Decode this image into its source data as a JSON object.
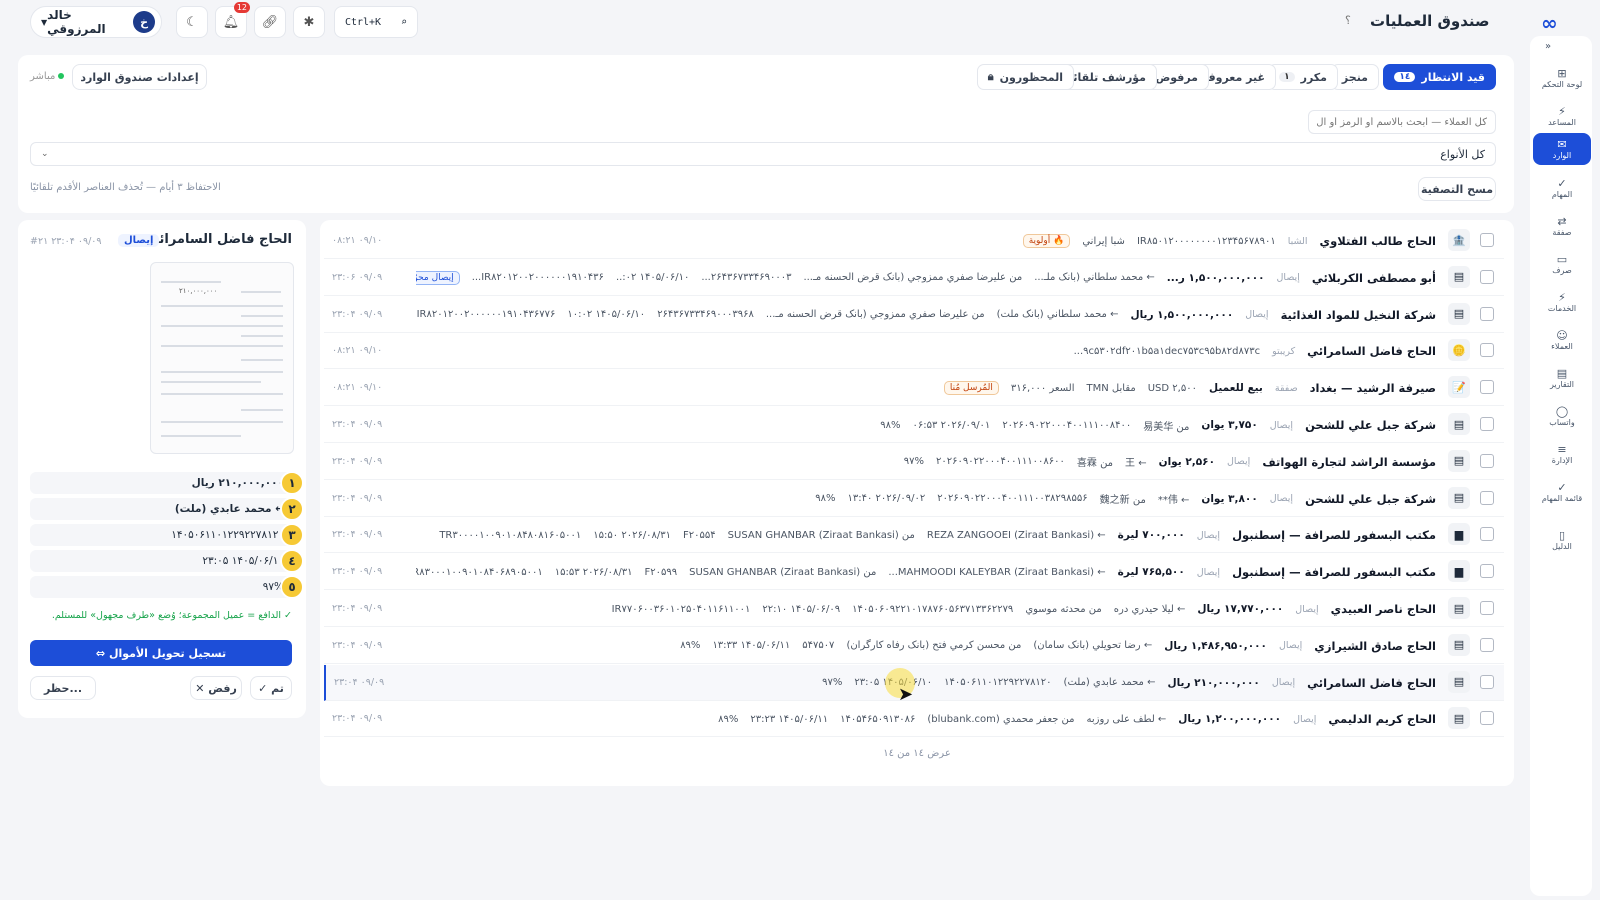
{
  "topbar": {
    "user_name": "خالد المرزوقي",
    "user_initial": "خ",
    "notif_count": "12",
    "search_shortcut": "Ctrl+K",
    "title": "صندوق العمليات",
    "help": "؟"
  },
  "sidebar": {
    "items": [
      {
        "label": "لوحة التحكم",
        "icon": "⊞"
      },
      {
        "label": "المساعد",
        "icon": "⚡"
      },
      {
        "label": "الوارد",
        "icon": "✉"
      },
      {
        "label": "المهام",
        "icon": "✓"
      },
      {
        "label": "صفقة",
        "icon": "⇄"
      },
      {
        "label": "صرف",
        "icon": "▭"
      },
      {
        "label": "الخدمات",
        "icon": "⚡"
      },
      {
        "label": "العملاء",
        "icon": "☺"
      },
      {
        "label": "التقارير",
        "icon": "▤"
      },
      {
        "label": "واتساب",
        "icon": "◯"
      },
      {
        "label": "الإدارة",
        "icon": "≡"
      },
      {
        "label": "قائمة المهام",
        "icon": "✓"
      },
      {
        "label": "الدليل",
        "icon": "▯"
      }
    ]
  },
  "filters": {
    "tabs": [
      {
        "label": "قيد الانتظار",
        "count": "١٤"
      },
      {
        "label": "منجز",
        "count": ""
      },
      {
        "label": "مكرر",
        "count": "١"
      },
      {
        "label": "غير معروف",
        "count": ""
      },
      {
        "label": "مرفوض",
        "count": ""
      },
      {
        "label": "مؤرشف تلقائيًا",
        "count": ""
      },
      {
        "label": "المحظورون",
        "count": ""
      }
    ],
    "inbox_settings": "إعدادات صندوق الوارد",
    "live": "مباشر",
    "search_placeholder": "كل العملاء — ابحث بالاسم أو الرمز أو ال",
    "type_select": "كل الأنواع",
    "clear": "مسح التصفية",
    "retention": "الاحتفاظ ٣ أيام — تُحذف العناصر الأقدم تلقائيًا"
  },
  "rows": [
    {
      "name": "الحاج طالب الفتلاوي",
      "type": "الشبا",
      "amount": "",
      "items": [
        "IR۸۵۰۱۲۰۰۰۰۰۰۰۰۱۲۳۴۵۶۷۸۹۰۱",
        "شبا إيراني"
      ],
      "pill": "🔥 أولوية",
      "pill2": "",
      "time": "۰۹/۱۰ ۰۸:۲۱",
      "icon": "🏦"
    },
    {
      "name": "أبو مصطفى الكربلائي",
      "type": "إيصال",
      "amount": "۱,۵۰۰,۰۰۰,۰۰۰ ر...",
      "items": [
        "← محمد سلطاني (بانک ملـ...",
        "من عليرضا صفري ممزوجي (بانک قرض الحسنه مـ...",
        "۲۶۴۳۶۷۳۳۴۶۹۰۰۰۳...",
        "۱۴۰۵/۰۶/۱۰ ۰۲:..",
        "IR۸۲۰۱۲۰۰۲۰۰۰۰۰۰۱۹۱۰۴۳۶..."
      ],
      "pill": "🔥 أولوية",
      "pill2": "إيصال محوّل من ٢٣#",
      "time": "۰۹/۰۹ ۲۳:۰۶",
      "icon": "▤"
    },
    {
      "name": "شركة النخيل للمواد الغذائية",
      "type": "إيصال",
      "amount": "۱,۵۰۰,۰۰۰,۰۰۰ ريال",
      "items": [
        "← محمد سلطاني (بانک ملت)",
        "من عليرضا صفري ممزوجي (بانک قرض الحسنه مـ...",
        "۲۶۴۳۶۷۳۳۴۶۹۰۰۰۳۹۶۸",
        "۱۴۰۵/۰۶/۱۰ ۱۰:۰۲",
        "IR۸۲۰۱۲۰۰۲۰۰۰۰۰۰۱۹۱۰۴۳۶۷۷۶"
      ],
      "pill": "🔥 أولوية",
      "pill2": "",
      "time": "۰۹/۰۹ ۲۳:۰۴",
      "icon": "▤"
    },
    {
      "name": "الحاج فاضل السامرائي",
      "type": "كريبتو",
      "amount": "",
      "items": [
        "۹c۵۳۰۲df۲۰۱b۵a۱dec۷۵۳c۹۵b۸۲d۸۷۳c..."
      ],
      "pill": "",
      "pill2": "",
      "time": "۰۹/۱۰ ۰۸:۲۱",
      "icon": "🪙"
    },
    {
      "name": "صيرفة الرشيد — بغداد",
      "type": "صفقة",
      "amount": "بيع للعميل",
      "items": [
        "USD ۲,۵۰۰",
        "مقابل TMN",
        "السعر ۳۱۶,۰۰۰"
      ],
      "pill": "المُرسل مُنا",
      "pill2": "",
      "time": "۰۹/۱۰ ۰۸:۲۱",
      "icon": "📝"
    },
    {
      "name": "شركة جبل علي للشحن",
      "type": "إيصال",
      "amount": "۳,۷۵۰ يوان",
      "items": [
        "من 易美华",
        "۲۰۲۶۰۹۰۲۲۰۰۰۴۰۰۱۱۱۰۰۸۴۰۰",
        "۲۰۲۶/۰۹/۰۱ ۰۶:۵۳",
        "۹۸%"
      ],
      "pill": "",
      "pill2": "",
      "time": "۰۹/۰۹ ۲۳:۰۴",
      "icon": "▤"
    },
    {
      "name": "مؤسسة الراشد لتجارة الهواتف",
      "type": "إيصال",
      "amount": "۲,۵۶۰ يوان",
      "items": [
        "← 王",
        "من 喜霖",
        "۲۰۲۶۰۹۰۲۲۰۰۰۴۰۰۱۱۱۰۰۸۶۰۰",
        "۹۷%"
      ],
      "pill": "",
      "pill2": "",
      "time": "۰۹/۰۹ ۲۳:۰۴",
      "icon": "▤"
    },
    {
      "name": "شركة جبل علي للشحن",
      "type": "إيصال",
      "amount": "۳,۸۰۰ يوان",
      "items": [
        "← 伟**",
        "من 魏之新",
        "۲۰۲۶۰۹۰۲۲۰۰۰۴۰۰۱۱۱۰۰۳۸۲۹۸۵۵۶",
        "۲۰۲۶/۰۹/۰۲ ۱۳:۴۰",
        "۹۸%"
      ],
      "pill": "",
      "pill2": "",
      "time": "۰۹/۰۹ ۲۳:۰۴",
      "icon": "▤"
    },
    {
      "name": "مكتب البسفور للصرافة — إسطنبول",
      "type": "إيصال",
      "amount": "۷۰۰,۰۰۰ ليرة",
      "items": [
        "← REZA ZANGOOEI (Ziraat Bankasi)",
        "من SUSAN GHANBAR (Ziraat Bankasi)",
        "F۲۰۵۵۴",
        "۲۰۲۶/۰۸/۳۱ ۱۵:۵۰",
        "TR۳۰۰۰۰۱۰۰۹۰۱۰۸۴۸۰۸۱۶۰۵۰۰۱"
      ],
      "pill": "",
      "pill2": "",
      "time": "۰۹/۰۹ ۲۳:۰۴",
      "icon": "▆"
    },
    {
      "name": "مكتب البسفور للصرافة — إسطنبول",
      "type": "إيصال",
      "amount": "۷۶۵,۵۰۰ ليرة",
      "items": [
        "← MAHMOODI KALEYBAR (Ziraat Bankasi)...",
        "من SUSAN GHANBAR (Ziraat Bankasi)",
        "F۲۰۵۹۹",
        "۲۰۲۶/۰۸/۳۱ ۱۵:۵۳",
        "TR۸۳۰۰۰۱۰۰۹۰۱۰۸۴۰۶۸۹۰۵۰۰۱"
      ],
      "pill": "",
      "pill2": "",
      "time": "۰۹/۰۹ ۲۳:۰۴",
      "icon": "▆"
    },
    {
      "name": "الحاج ناصر العبيدي",
      "type": "إيصال",
      "amount": "۱۷,۷۷۰,۰۰۰ ريال",
      "items": [
        "← ليلا حيدري دره",
        "من محدثه موسوي",
        "۱۴۰۵۰۶۰۹۲۲۱۰۱۷۸۷۶۰۵۶۳۷۱۳۳۶۲۲۷۹",
        "۱۴۰۵/۰۶/۰۹ ۲۲:۱۰",
        "IR۷۷۰۶۰۰۳۶۰۱۰۲۵۰۴۰۱۱۶۱۱۰۰۱"
      ],
      "pill": "",
      "pill2": "",
      "time": "۰۹/۰۹ ۲۳:۰۴",
      "icon": "▤"
    },
    {
      "name": "الحاج صادق الشيرازي",
      "type": "إيصال",
      "amount": "۱,۴۸۶,۹۵۰,۰۰۰ ريال",
      "items": [
        "← رضا تحويلي (بانک سامان)",
        "من محسن كرمي فتح (بانک رفاه کارگران)",
        "۵۴۷۵۰۷",
        "۱۴۰۵/۰۶/۱۱ ۱۳:۳۳",
        "۸۹%"
      ],
      "pill": "",
      "pill2": "",
      "time": "۰۹/۰۹ ۲۳:۰۴",
      "icon": "▤"
    },
    {
      "name": "الحاج فاضل السامرائي",
      "type": "إيصال",
      "amount": "۲۱۰,۰۰۰,۰۰۰ ريال",
      "items": [
        "← محمد عابدي (ملت)",
        "۱۴۰۵۰۶۱۱۰۱۲۲۹۲۲۷۸۱۲۰",
        "۱۴۰۵/۰۶/۱۰ ۲۳:۰۵",
        "۹۷%"
      ],
      "pill": "",
      "pill2": "",
      "time": "۰۹/۰۹ ۲۳:۰۴",
      "icon": "▤"
    },
    {
      "name": "الحاج كريم الدليمي",
      "type": "إيصال",
      "amount": "۱,۲۰۰,۰۰۰,۰۰۰ ريال",
      "items": [
        "← لطف على روزبه",
        "من جعفر محمدي (blubank.com)",
        "۱۴۰۵۴۶۵۰۹۱۳۰۸۶",
        "۱۴۰۵/۰۶/۱۱ ۲۳:۲۳",
        "۸۹%"
      ],
      "pill": "",
      "pill2": "",
      "time": "۰۹/۰۹ ۲۳:۰۴",
      "icon": "▤"
    }
  ],
  "list_footer": "عرض ١٤ من ١٤",
  "detail": {
    "title": "الحاج فاضل السامرائي",
    "badge": "إيصال",
    "time": "۰۹/۰۹ ۲۳:۰۴ #۲۱",
    "thumb_amount": "۲۱۰,۰۰۰,۰۰۰",
    "fields": [
      {
        "marker": "١",
        "value": "۲۱۰,۰۰۰,۰۰۰ ريال"
      },
      {
        "marker": "٢",
        "value": "← محمد عابدي (ملت)"
      },
      {
        "marker": "٣",
        "value": "۱۴۰۵۰۶۱۱۰۱۲۲۹۲۲۷۸۱۲۰"
      },
      {
        "marker": "٤",
        "value": "۱۴۰۵/۰۶/۱۰ ۲۳:۰۵"
      },
      {
        "marker": "٥",
        "value": "۹۷%"
      }
    ],
    "note": "✓ الدافع = عميل المجموعة؛ وُضع «طرف مجهول» للمستلم.",
    "primary": "⇔ تسجيل تحويل الأموال",
    "done": "✓ تم",
    "reject": "✕ رفض",
    "block": "حظر..."
  }
}
